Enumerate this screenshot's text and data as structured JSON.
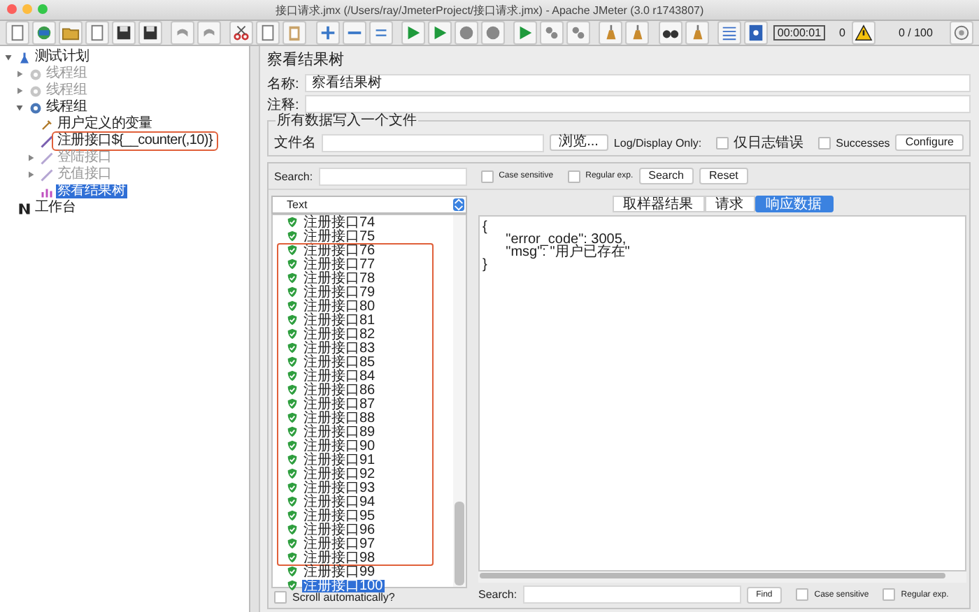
{
  "window": {
    "title": "接口请求.jmx (/Users/ray/JmeterProject/接口请求.jmx) - Apache JMeter (3.0 r1743807)"
  },
  "toolbar": {
    "timer": "00:00:01",
    "warnings": "0",
    "threads": "0 / 100"
  },
  "tree": [
    {
      "label": "测试计划",
      "kind": "plan",
      "expanded": true,
      "enabled": true,
      "selected": false,
      "annotated": false,
      "children": [
        {
          "label": "线程组",
          "kind": "group",
          "expanded": false,
          "enabled": false,
          "selected": false,
          "annotated": false
        },
        {
          "label": "线程组",
          "kind": "group",
          "expanded": false,
          "enabled": false,
          "selected": false,
          "annotated": false
        },
        {
          "label": "线程组",
          "kind": "group",
          "expanded": true,
          "enabled": true,
          "selected": false,
          "annotated": false,
          "children": [
            {
              "label": "用户定义的变量",
              "kind": "config",
              "enabled": true,
              "selected": false,
              "annotated": false
            },
            {
              "label": "注册接口${__counter(,10)}",
              "kind": "sampler",
              "enabled": true,
              "selected": false,
              "annotated": true
            },
            {
              "label": "登陆接口",
              "kind": "sampler",
              "expanded": false,
              "enabled": false,
              "selected": false,
              "annotated": false
            },
            {
              "label": "充值接口",
              "kind": "sampler",
              "expanded": false,
              "enabled": false,
              "selected": false,
              "annotated": false
            },
            {
              "label": "察看结果树",
              "kind": "listener",
              "enabled": true,
              "selected": true,
              "annotated": false
            }
          ]
        }
      ]
    },
    {
      "label": "工作台",
      "kind": "workbench",
      "enabled": true,
      "selected": false,
      "annotated": false
    }
  ],
  "panel": {
    "title": "察看结果树",
    "name_label": "名称:",
    "name_value": "察看结果树",
    "comment_label": "注释:",
    "file_group": {
      "legend": "所有数据写入一个文件",
      "file_label": "文件名",
      "browse": "浏览...",
      "log_label": "Log/Display Only:",
      "errors": {
        "label": "仅日志错误",
        "checked": false
      },
      "successes": {
        "label": "Successes",
        "checked": false
      },
      "configure": "Configure"
    }
  },
  "results": {
    "search_label": "Search:",
    "case_sensitive": {
      "label": "Case sensitive",
      "checked": false
    },
    "regex": {
      "label": "Regular exp.",
      "checked": false
    },
    "search_button": "Search",
    "reset_button": "Reset",
    "renderer": "Text",
    "samples": [
      {
        "label": "注册接口74",
        "success": true,
        "selected": false,
        "annotated": false
      },
      {
        "label": "注册接口75",
        "success": true,
        "selected": false,
        "annotated": false
      },
      {
        "label": "注册接口76",
        "success": true,
        "selected": false,
        "annotated": true
      },
      {
        "label": "注册接口77",
        "success": true,
        "selected": false,
        "annotated": true
      },
      {
        "label": "注册接口78",
        "success": true,
        "selected": false,
        "annotated": true
      },
      {
        "label": "注册接口79",
        "success": true,
        "selected": false,
        "annotated": true
      },
      {
        "label": "注册接口80",
        "success": true,
        "selected": false,
        "annotated": true
      },
      {
        "label": "注册接口81",
        "success": true,
        "selected": false,
        "annotated": true
      },
      {
        "label": "注册接口82",
        "success": true,
        "selected": false,
        "annotated": true
      },
      {
        "label": "注册接口83",
        "success": true,
        "selected": false,
        "annotated": true
      },
      {
        "label": "注册接口85",
        "success": true,
        "selected": false,
        "annotated": true
      },
      {
        "label": "注册接口84",
        "success": true,
        "selected": false,
        "annotated": true
      },
      {
        "label": "注册接口86",
        "success": true,
        "selected": false,
        "annotated": true
      },
      {
        "label": "注册接口87",
        "success": true,
        "selected": false,
        "annotated": true
      },
      {
        "label": "注册接口88",
        "success": true,
        "selected": false,
        "annotated": true
      },
      {
        "label": "注册接口89",
        "success": true,
        "selected": false,
        "annotated": true
      },
      {
        "label": "注册接口90",
        "success": true,
        "selected": false,
        "annotated": true
      },
      {
        "label": "注册接口91",
        "success": true,
        "selected": false,
        "annotated": true
      },
      {
        "label": "注册接口92",
        "success": true,
        "selected": false,
        "annotated": true
      },
      {
        "label": "注册接口93",
        "success": true,
        "selected": false,
        "annotated": true
      },
      {
        "label": "注册接口94",
        "success": true,
        "selected": false,
        "annotated": true
      },
      {
        "label": "注册接口95",
        "success": true,
        "selected": false,
        "annotated": true
      },
      {
        "label": "注册接口96",
        "success": true,
        "selected": false,
        "annotated": true
      },
      {
        "label": "注册接口97",
        "success": true,
        "selected": false,
        "annotated": true
      },
      {
        "label": "注册接口98",
        "success": true,
        "selected": false,
        "annotated": true
      },
      {
        "label": "注册接口99",
        "success": true,
        "selected": false,
        "annotated": false
      },
      {
        "label": "注册接口100",
        "success": true,
        "selected": true,
        "annotated": false
      }
    ],
    "scroll_auto": {
      "label": "Scroll automatically?",
      "checked": false
    },
    "tabs": [
      {
        "label": "取样器结果",
        "selected": false
      },
      {
        "label": "请求",
        "selected": false
      },
      {
        "label": "响应数据",
        "selected": true
      }
    ],
    "response": "{\n      \"error_code\": 3005,\n      \"msg\": \"用户已存在\"\n}",
    "find_label": "Search:",
    "find_button": "Find",
    "find_case": {
      "label": "Case sensitive",
      "checked": false
    },
    "find_regex": {
      "label": "Regular exp.",
      "checked": false
    }
  }
}
